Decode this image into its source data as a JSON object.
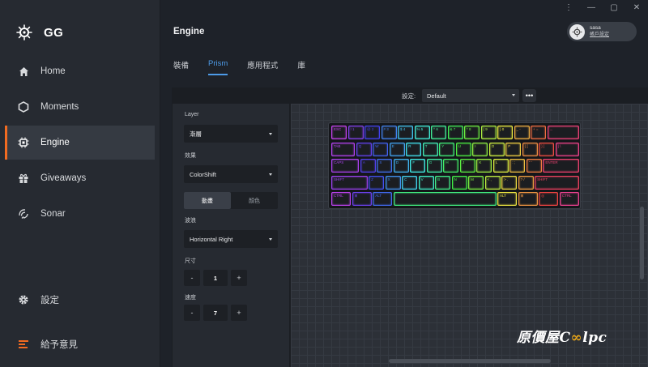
{
  "window": {
    "controls": [
      "⋮",
      "—",
      "▢",
      "✕"
    ]
  },
  "app": {
    "name": "GG"
  },
  "sidebar": {
    "items": [
      {
        "label": "Home",
        "icon": "home-icon"
      },
      {
        "label": "Moments",
        "icon": "hexagon-icon"
      },
      {
        "label": "Engine",
        "icon": "chip-icon",
        "active": true
      },
      {
        "label": "Giveaways",
        "icon": "gift-icon"
      },
      {
        "label": "Sonar",
        "icon": "sonar-icon"
      }
    ],
    "settings_label": "設定",
    "feedback_label": "給予意見",
    "accent": "#f26b21"
  },
  "header": {
    "title": "Engine",
    "user": {
      "name": "sasa",
      "settings": "帳戶設定"
    }
  },
  "tabs": [
    "裝備",
    "Prism",
    "應用程式",
    "庫"
  ],
  "active_tab": "Prism",
  "config": {
    "label": "設定:",
    "value": "Default",
    "more": "•••"
  },
  "panel": {
    "layer_label": "Layer",
    "layer_value": "漸層",
    "effect_label": "效果",
    "effect_value": "ColorShift",
    "seg_left": "動畫",
    "seg_right": "顏色",
    "wave_label": "波浪",
    "wave_value": "Horizontal Right",
    "size_label": "尺寸",
    "size_value": "1",
    "speed_label": "速度",
    "speed_value": "7",
    "minus": "-",
    "plus": "+"
  },
  "keyboard": {
    "rows": [
      [
        "ESC",
        "! 1",
        "@ 2",
        "# 3",
        "$ 4",
        "% 5",
        "^ 6",
        "& 7",
        "* 8",
        "( 9",
        ") 0",
        "_ -",
        "+ =",
        "←"
      ],
      [
        "TAB",
        "Q",
        "W",
        "E",
        "R",
        "T",
        "Y",
        "U",
        "I",
        "O",
        "P",
        "{ [",
        "} ]",
        "| \\"
      ],
      [
        "CAPS",
        "A",
        "S",
        "D",
        "F",
        "G",
        "H",
        "J",
        "K",
        "L",
        ": ;",
        "\" '",
        "ENTER"
      ],
      [
        "SHIFT",
        "Z",
        "X",
        "C",
        "V",
        "B",
        "N",
        "M",
        "< ,",
        "> .",
        "? /",
        "SHIFT"
      ],
      [
        "CTRL",
        "⊞",
        "ALT",
        "",
        "ALT",
        "⊞",
        "◎",
        "CTRL"
      ]
    ]
  },
  "watermark": {
    "text": "原價屋C",
    "loop": "∞",
    "tail": "lpc"
  }
}
